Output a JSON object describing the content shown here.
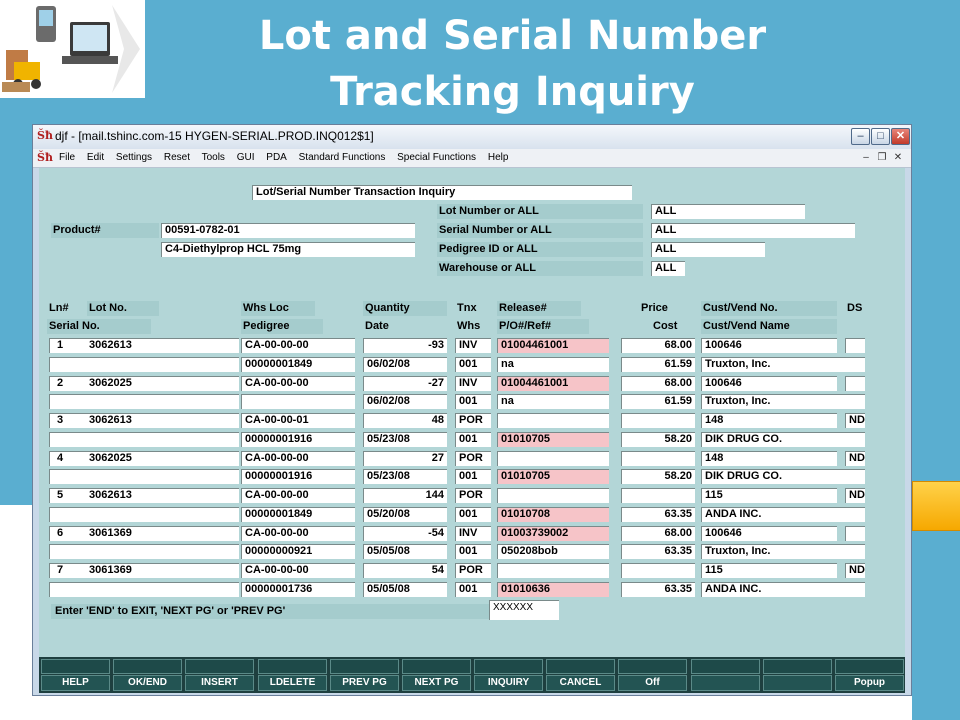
{
  "slide": {
    "title_line1": "Lot and Serial Number",
    "title_line2": "Tracking Inquiry"
  },
  "window": {
    "title": "djf - [mail.tshinc.com-15 HYGEN-SERIAL.PROD.INQ012$1]",
    "app_icon": "Šħ",
    "menu": [
      "File",
      "Edit",
      "Settings",
      "Reset",
      "Tools",
      "GUI",
      "PDA",
      "Standard Functions",
      "Special Functions",
      "Help"
    ]
  },
  "form": {
    "heading": "Lot/Serial Number Transaction Inquiry",
    "product_label": "Product#",
    "product_code": "00591-0782-01",
    "product_desc": "C4-Diethylprop HCL 75mg",
    "lot_label": "Lot Number or ALL",
    "lot_value": "ALL",
    "serial_label": "Serial Number or ALL",
    "serial_value": "ALL",
    "pedigree_label": "Pedigree ID or ALL",
    "pedigree_value": "ALL",
    "warehouse_label": "Warehouse or ALL",
    "warehouse_value": "ALL"
  },
  "headers": {
    "ln": "Ln#",
    "lot_no": "Lot No.",
    "whs_loc": "Whs Loc",
    "quantity": "Quantity",
    "tnx": "Tnx",
    "release": "Release#",
    "price": "Price",
    "cust_vend_no": "Cust/Vend No.",
    "ds": "DS",
    "serial_no": "Serial No.",
    "pedigree": "Pedigree",
    "date": "Date",
    "whs": "Whs",
    "po_ref": "P/O#/Ref#",
    "cost": "Cost",
    "cust_vend_name": "Cust/Vend Name"
  },
  "rows": [
    {
      "ln": "1",
      "lot": "3062613",
      "loc": "CA-00-00-00",
      "qty": "-93",
      "tnx": "INV",
      "release": "01004461001",
      "price": "68.00",
      "cust_no": "100646",
      "ds": "",
      "serial": "",
      "pedigree": "00000001849",
      "date": "06/02/08",
      "whs": "001",
      "ref": "na",
      "cost": "61.59",
      "cust_name": "Truxton, Inc."
    },
    {
      "ln": "2",
      "lot": "3062025",
      "loc": "CA-00-00-00",
      "qty": "-27",
      "tnx": "INV",
      "release": "01004461001",
      "price": "68.00",
      "cust_no": "100646",
      "ds": "",
      "serial": "",
      "pedigree": "",
      "date": "06/02/08",
      "whs": "001",
      "ref": "na",
      "cost": "61.59",
      "cust_name": "Truxton, Inc."
    },
    {
      "ln": "3",
      "lot": "3062613",
      "loc": "CA-00-00-01",
      "qty": "48",
      "tnx": "POR",
      "release": "",
      "price": "",
      "cust_no": "148",
      "ds": "ND",
      "serial": "",
      "pedigree": "00000001916",
      "date": "05/23/08",
      "whs": "001",
      "ref": "01010705",
      "cost": "58.20",
      "cust_name": "DIK DRUG CO."
    },
    {
      "ln": "4",
      "lot": "3062025",
      "loc": "CA-00-00-00",
      "qty": "27",
      "tnx": "POR",
      "release": "",
      "price": "",
      "cust_no": "148",
      "ds": "ND",
      "serial": "",
      "pedigree": "00000001916",
      "date": "05/23/08",
      "whs": "001",
      "ref": "01010705",
      "cost": "58.20",
      "cust_name": "DIK DRUG CO."
    },
    {
      "ln": "5",
      "lot": "3062613",
      "loc": "CA-00-00-00",
      "qty": "144",
      "tnx": "POR",
      "release": "",
      "price": "",
      "cust_no": "115",
      "ds": "ND",
      "serial": "",
      "pedigree": "00000001849",
      "date": "05/20/08",
      "whs": "001",
      "ref": "01010708",
      "cost": "63.35",
      "cust_name": "ANDA INC."
    },
    {
      "ln": "6",
      "lot": "3061369",
      "loc": "CA-00-00-00",
      "qty": "-54",
      "tnx": "INV",
      "release": "01003739002",
      "price": "68.00",
      "cust_no": "100646",
      "ds": "",
      "serial": "",
      "pedigree": "00000000921",
      "date": "05/05/08",
      "whs": "001",
      "ref": "050208bob",
      "cost": "63.35",
      "cust_name": "Truxton, Inc."
    },
    {
      "ln": "7",
      "lot": "3061369",
      "loc": "CA-00-00-00",
      "qty": "54",
      "tnx": "POR",
      "release": "",
      "price": "",
      "cust_no": "115",
      "ds": "ND",
      "serial": "",
      "pedigree": "00000001736",
      "date": "05/05/08",
      "whs": "001",
      "ref": "01010636",
      "cost": "63.35",
      "cust_name": "ANDA INC."
    }
  ],
  "status": {
    "prompt": "Enter 'END' to EXIT, 'NEXT PG' or 'PREV PG'",
    "input": "XXXXXX"
  },
  "fkeys": [
    "HELP",
    "OK/END",
    "INSERT",
    "LDELETE",
    "PREV PG",
    "NEXT PG",
    "INQUIRY",
    "CANCEL",
    "Off",
    "",
    "",
    "Popup"
  ],
  "colors": {
    "slide_accent": "#5aaed0",
    "form_bg": "#b3d6d7",
    "highlight": "#f6c4c8"
  }
}
